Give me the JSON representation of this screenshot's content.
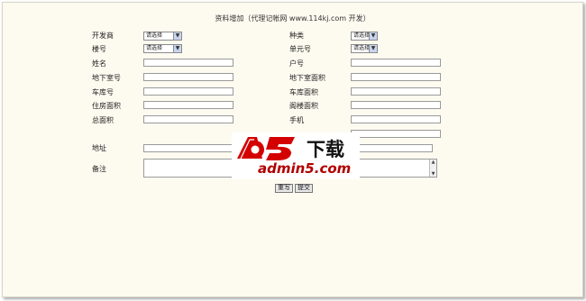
{
  "header": {
    "title": "资料增加（代理记帐网 www.114kj.com 开发）"
  },
  "form": {
    "developer_label": "开发商",
    "developer_value": "请选择",
    "type_label": "种类",
    "type_value": "请选择",
    "building_label": "楼号",
    "building_value": "请选择",
    "unit_label": "单元号",
    "unit_value": "请选择",
    "name_label": "姓名",
    "room_label": "户号",
    "basement_label": "地下室号",
    "basement_area_label": "地下室面积",
    "garage_label": "车库号",
    "garage_area_label": "车库面积",
    "housing_area_label": "住房面积",
    "attic_area_label": "阁楼面积",
    "total_area_label": "总面积",
    "phone_label": "手机",
    "address_label": "地址",
    "remarks_label": "备注"
  },
  "buttons": {
    "reset": "重写",
    "submit": "提交"
  },
  "watermark": {
    "brand": "a5",
    "download": "下载",
    "site": "admin5.com"
  }
}
